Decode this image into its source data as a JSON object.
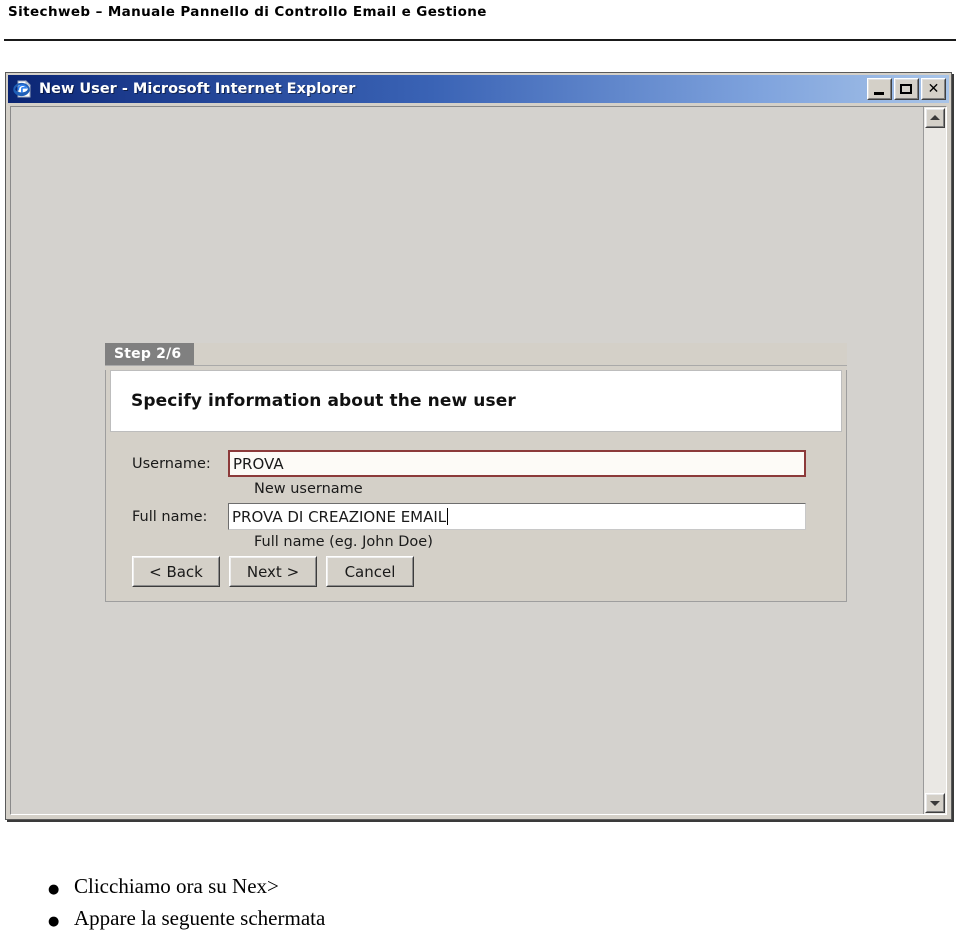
{
  "document": {
    "header_title": "Sitechweb – Manuale Pannello di Controllo Email e Gestione"
  },
  "browser_window": {
    "icon": "internet-explorer-icon",
    "title": "New User - Microsoft Internet Explorer",
    "controls": {
      "minimize_label": "_",
      "maximize_label": "□",
      "close_label": "✕"
    },
    "scrollbar": {
      "up_arrow": "scroll-up-arrow",
      "down_arrow": "scroll-down-arrow"
    }
  },
  "wizard": {
    "step_label": "Step 2/6",
    "headline": "Specify information about the new user",
    "fields": [
      {
        "label": "Username:",
        "value": "PROVA",
        "hint": "New username",
        "state": "error"
      },
      {
        "label": "Full name:",
        "value": "PROVA DI CREAZIONE EMAIL",
        "hint": "Full name (eg. John Doe)",
        "state": "focused"
      }
    ],
    "buttons": {
      "back": "< Back",
      "next": "Next >",
      "cancel": "Cancel"
    }
  },
  "caption": {
    "bullet_glyph": "●",
    "items": [
      "Clicchiamo ora su Nex>",
      "Appare la seguente schermata"
    ]
  },
  "colors": {
    "titlebar_start": "#0a2472",
    "titlebar_end": "#a8c4e8",
    "window_face": "#d4d0c8",
    "client_bg": "#d4d2ce",
    "step_tab_bg": "#808080",
    "error_border": "#8c3a3a",
    "error_fill": "#fdfbf7"
  }
}
